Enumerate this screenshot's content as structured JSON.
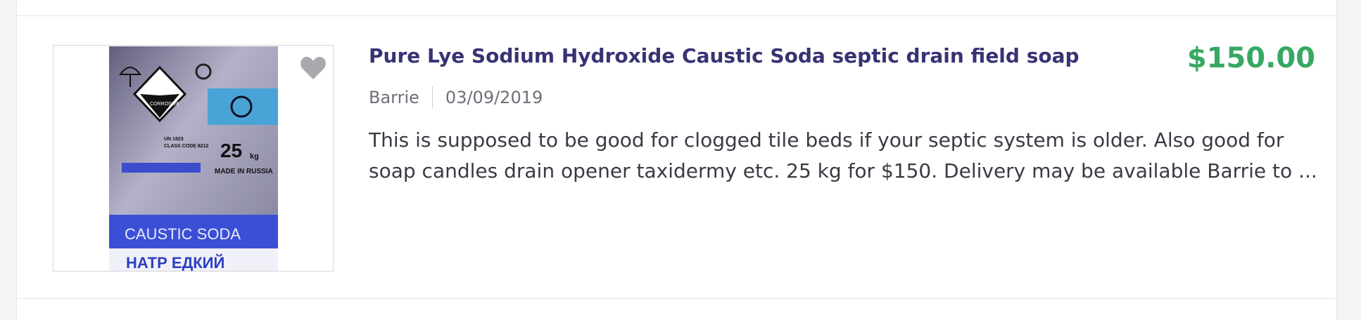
{
  "listing": {
    "title": "Pure Lye Sodium Hydroxide Caustic Soda septic drain field soap",
    "price": "$150.00",
    "location": "Barrie",
    "date": "03/09/2019",
    "description": "This is supposed to be good for clogged tile beds if your septic system is older. Also good for soap candles drain opener taxidermy etc. 25 kg for $150. Delivery may be available Barrie to ...",
    "favorite_icon": "heart-icon"
  },
  "image": {
    "bag_lines": {
      "hazard": "CORROSIVE",
      "un": "UN 1823",
      "class": "CLASS CODE 8212",
      "weight": "25",
      "unit": "kg",
      "made_in": "MADE IN RUSSIA",
      "brand": "CAUSTIC SODA",
      "russian": "НАТР ЕДКИЙ"
    }
  },
  "colors": {
    "title": "#373373",
    "price": "#37a864",
    "meta": "#6f6f78",
    "text": "#3a3a44"
  }
}
